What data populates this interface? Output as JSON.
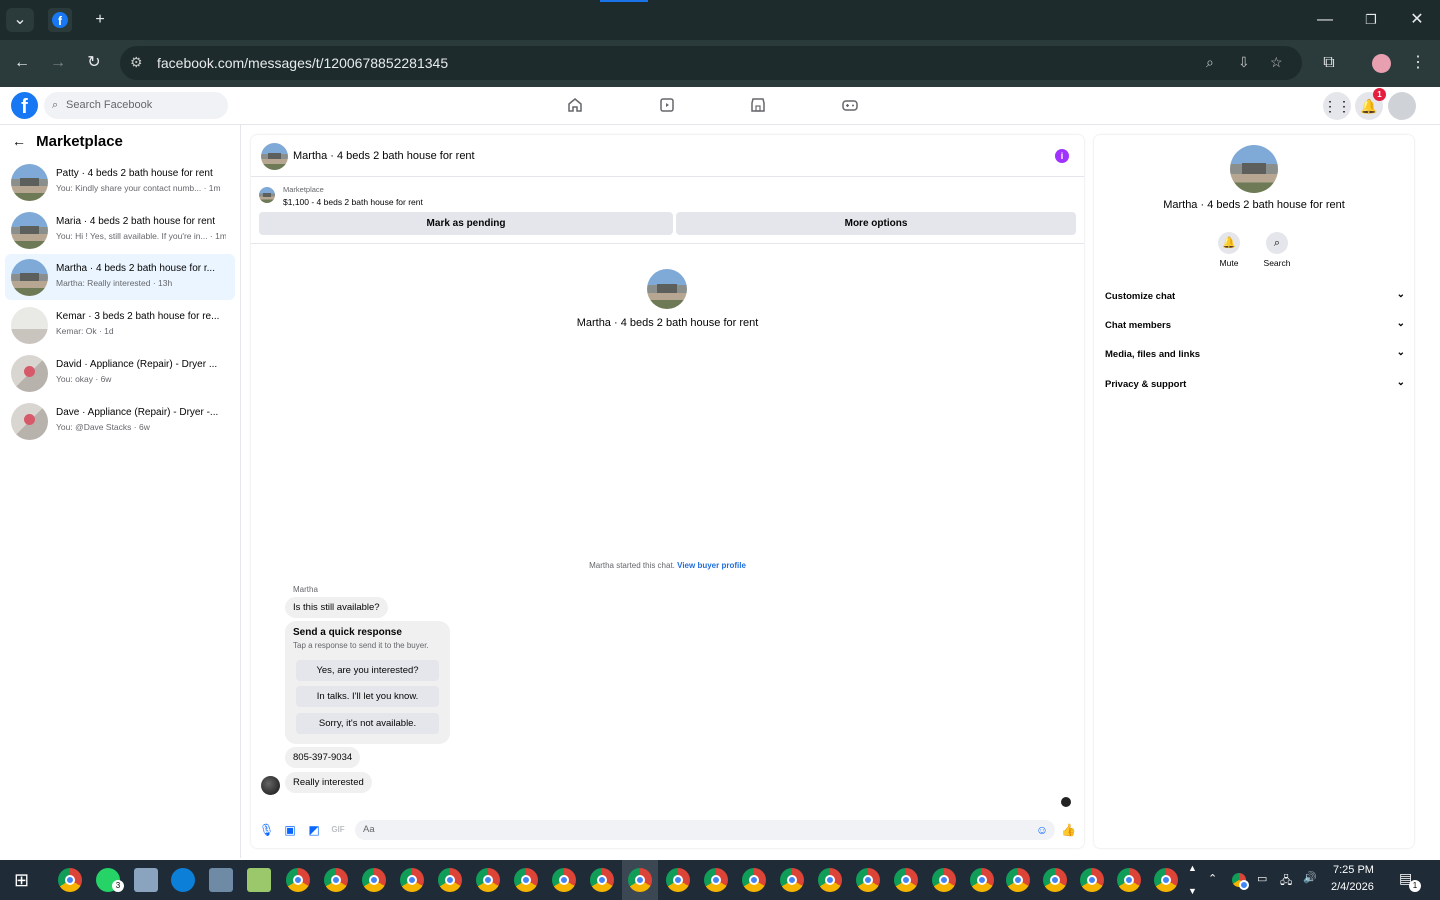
{
  "browser": {
    "url": "facebook.com/messages/t/1200678852281345",
    "tab_icon": "facebook-icon"
  },
  "fb": {
    "search_placeholder": "Search Facebook",
    "notification_count": "1"
  },
  "sidebar": {
    "title": "Marketplace",
    "conversations": [
      {
        "name": "Patty · 4 beds 2 bath house for rent",
        "snippet": "You: Kindly share your contact numb... · 1m",
        "thumb": "house"
      },
      {
        "name": "Maria · 4 beds 2 bath house for rent",
        "snippet": "You: Hi ! Yes, still available. If you're in... · 1m",
        "thumb": "house"
      },
      {
        "name": "Martha · 4 beds 2 bath house for r...",
        "snippet": "Martha: Really interested · 13h",
        "thumb": "house",
        "active": true
      },
      {
        "name": "Kemar · 3 beds 2 bath house for re...",
        "snippet": "Kemar: Ok · 1d",
        "thumb": "room"
      },
      {
        "name": "David · Appliance (Repair) - Dryer ...",
        "snippet": "You: okay · 6w",
        "thumb": "appliance"
      },
      {
        "name": "Dave · Appliance (Repair) - Dryer -...",
        "snippet": "You: @Dave Stacks · 6w",
        "thumb": "appliance"
      }
    ]
  },
  "chat": {
    "header_title": "Martha · 4 beds 2 bath house for rent",
    "listing_category": "Marketplace",
    "listing_price": "$1,100 - 4 beds 2 bath house for rent",
    "mark_pending": "Mark as pending",
    "more_options": "More options",
    "center_title": "Martha · 4 beds 2 bath house for rent",
    "started_text": "Martha started this chat.",
    "view_buyer": "View buyer profile",
    "sender_name": "Martha",
    "msg1": "Is this still available?",
    "quick_title": "Send a quick response",
    "quick_sub": "Tap a response to send it to the buyer.",
    "quick_options": [
      "Yes, are you interested?",
      "In talks. I'll let you know.",
      "Sorry, it's not available."
    ],
    "msg2": "805-397-9034",
    "msg3": "Really interested",
    "composer_placeholder": "Aa"
  },
  "info": {
    "title": "Martha · 4 beds 2 bath house for rent",
    "mute": "Mute",
    "search": "Search",
    "sections": [
      "Customize chat",
      "Chat members",
      "Media, files and links",
      "Privacy & support"
    ]
  },
  "taskbar": {
    "time": "7:25 PM",
    "date": "2/4/2026",
    "whatsapp_badge": "3",
    "notif_badge": "1"
  }
}
